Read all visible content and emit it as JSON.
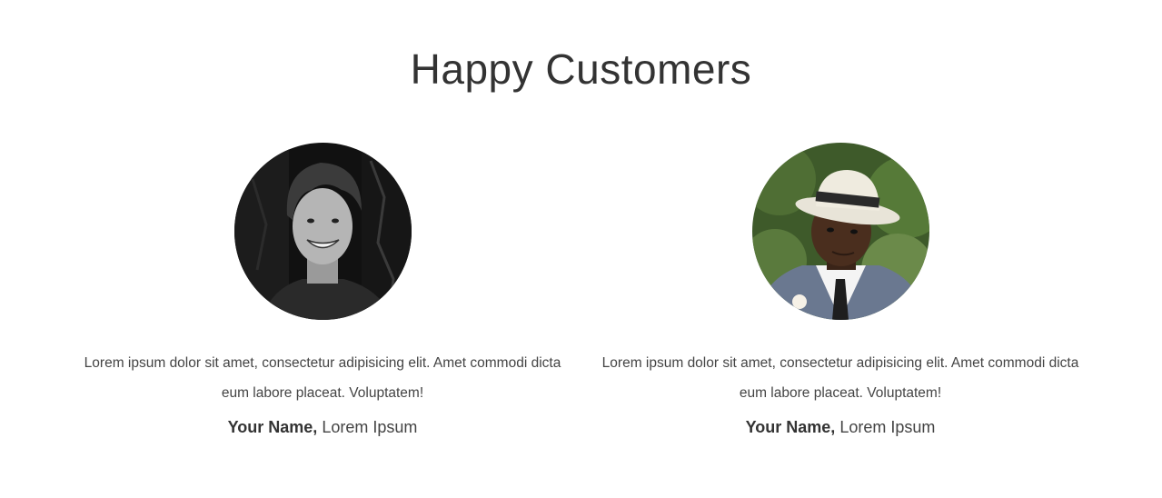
{
  "section": {
    "title": "Happy Customers"
  },
  "testimonials": [
    {
      "quote": "Lorem ipsum dolor sit amet, consectetur adipisicing elit. Amet commodi dicta eum labore placeat. Voluptatem!",
      "name": "Your Name,",
      "role": "Lorem Ipsum"
    },
    {
      "quote": "Lorem ipsum dolor sit amet, consectetur adipisicing elit. Amet commodi dicta eum labore placeat. Voluptatem!",
      "name": "Your Name,",
      "role": "Lorem Ipsum"
    }
  ]
}
